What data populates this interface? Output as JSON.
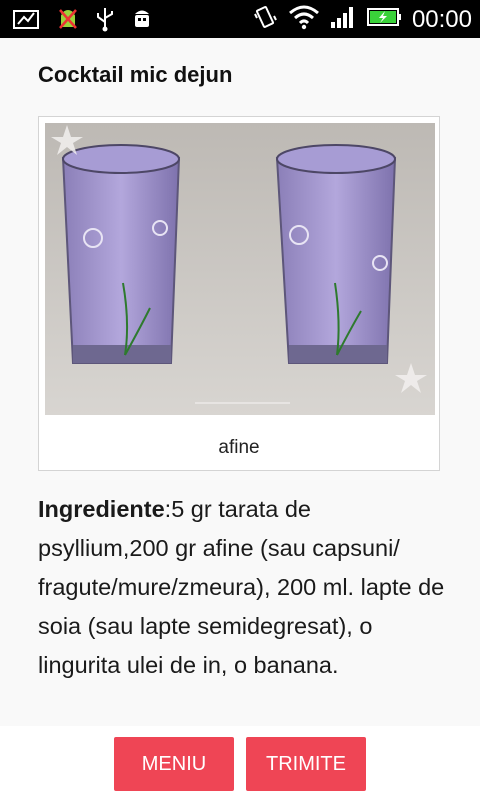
{
  "status_bar": {
    "time": "00:00",
    "icons": [
      "screenshot-icon",
      "android-debug-icon",
      "usb-icon",
      "android-icon",
      "vibrate-icon",
      "wifi-icon",
      "signal-icon",
      "battery-charging-icon"
    ]
  },
  "article": {
    "title": "Cocktail mic dejun",
    "image_caption": "afine",
    "ingredients_label": "Ingrediente",
    "ingredients_text": ":5 gr tarata de psyllium,200 gr afine (sau capsuni/ fragute/mure/zmeura), 200 ml. lapte de soia (sau lapte semidegresat), o lingurita ulei de in,  o banana."
  },
  "buttons": {
    "menu_label": "MENIU",
    "send_label": "TRIMITE"
  },
  "colors": {
    "accent": "#ef4555",
    "status_bar": "#000000",
    "battery": "#3ad23a"
  }
}
